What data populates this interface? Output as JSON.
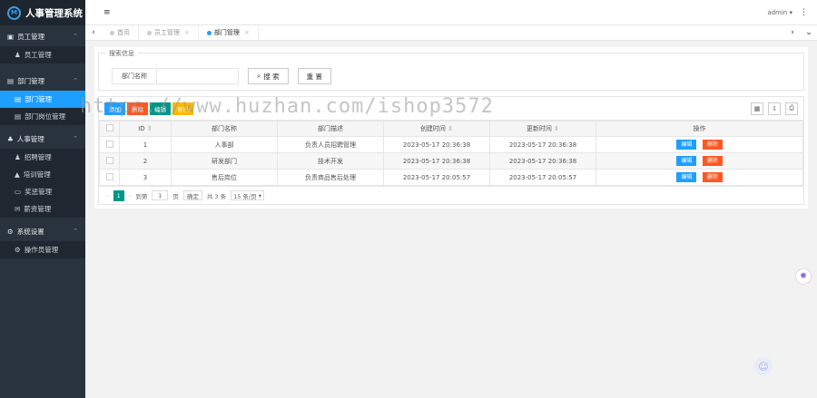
{
  "app": {
    "title": "人事管理系统",
    "logo_letter": "M"
  },
  "sidebar": {
    "groups": [
      {
        "label": "员工管理",
        "icon": "id-card-icon",
        "items": [
          {
            "label": "员工管理"
          }
        ]
      },
      {
        "label": "部门管理",
        "icon": "card-icon",
        "items": [
          {
            "label": "部门管理"
          },
          {
            "label": "部门岗位管理"
          }
        ]
      },
      {
        "label": "人事管理",
        "icon": "users-icon",
        "items": [
          {
            "label": "招聘管理"
          },
          {
            "label": "培训管理"
          },
          {
            "label": "奖惩管理"
          },
          {
            "label": "薪资管理"
          }
        ]
      },
      {
        "label": "系统设置",
        "icon": "gears-icon",
        "items": [
          {
            "label": "操作员管理"
          }
        ]
      }
    ]
  },
  "topbar": {
    "user": "admin",
    "user_caret": "▾"
  },
  "tabs": [
    {
      "label": "首页",
      "active": false
    },
    {
      "label": "员工管理",
      "active": false
    },
    {
      "label": "部门管理",
      "active": true
    }
  ],
  "search": {
    "legend": "搜索信息",
    "label": "部门名称",
    "value": "",
    "search_btn": "搜 索",
    "reset_btn": "重 置"
  },
  "toolbar": {
    "buttons": [
      {
        "label": "添加",
        "color": "#1e9fff"
      },
      {
        "label": "删除",
        "color": "#ff5722"
      },
      {
        "label": "编辑",
        "color": "#009688"
      },
      {
        "label": "导出",
        "color": "#ffb800"
      }
    ]
  },
  "table": {
    "columns": [
      "ID",
      "部门名称",
      "部门描述",
      "创建时间",
      "更新时间",
      "操作"
    ],
    "sort_mark": "⇕",
    "rows": [
      {
        "id": "1",
        "name": "人事部",
        "desc": "负责人员招聘管理",
        "created": "2023-05-17 20:36:38",
        "updated": "2023-05-17 20:36:38"
      },
      {
        "id": "2",
        "name": "研发部门",
        "desc": "技术开发",
        "created": "2023-05-17 20:36:38",
        "updated": "2023-05-17 20:36:38"
      },
      {
        "id": "3",
        "name": "售后岗位",
        "desc": "负责商品售后处理",
        "created": "2023-05-17 20:05:57",
        "updated": "2023-05-17 20:05:57"
      }
    ],
    "edit_label": "编辑",
    "delete_label": "删除",
    "edit_color": "#1e9fff",
    "delete_color": "#ff5722"
  },
  "pager": {
    "prev": "‹",
    "current": "1",
    "next": "›",
    "goto_label": "到第",
    "goto_value": "1",
    "page_unit": "页",
    "confirm": "确定",
    "total": "共 3 条",
    "page_size": "15 条/页"
  },
  "watermark": "https://www.huzhan.com/ishop3572"
}
